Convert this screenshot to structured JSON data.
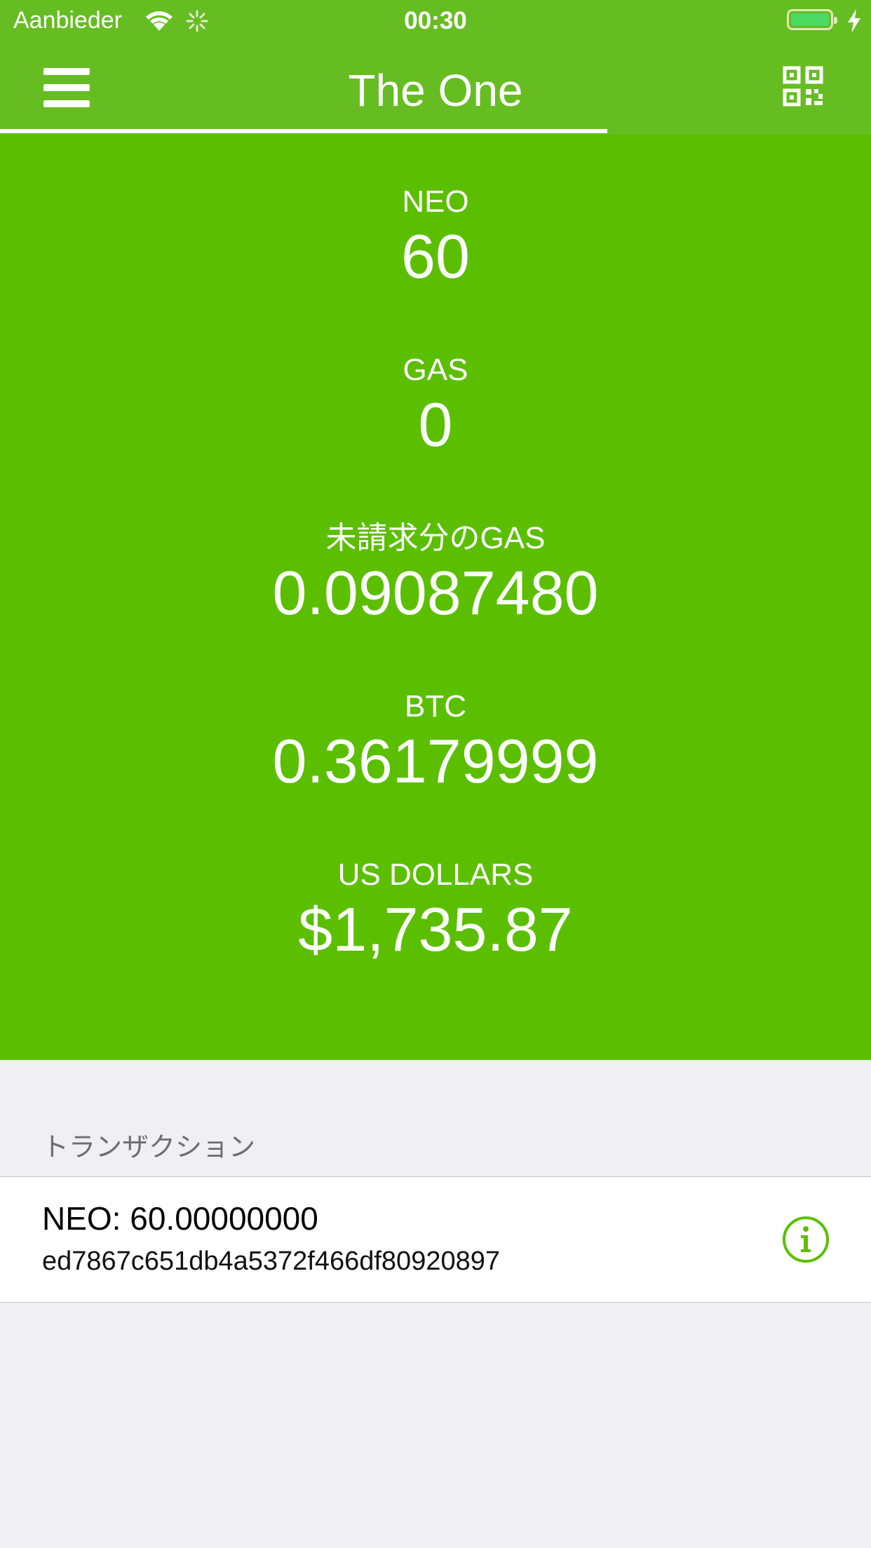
{
  "status_bar": {
    "carrier": "Aanbieder",
    "time": "00:30",
    "battery_level": 1.0
  },
  "nav": {
    "title": "The One",
    "left_icon": "menu-icon",
    "right_icon": "qr-code-icon"
  },
  "balances": [
    {
      "label": "NEO",
      "value": "60"
    },
    {
      "label": "GAS",
      "value": "0"
    },
    {
      "label": "未請求分のGAS",
      "value": "0.09087480"
    },
    {
      "label": "BTC",
      "value": "0.36179999"
    },
    {
      "label": "US DOLLARS",
      "value": "$1,735.87"
    }
  ],
  "transactions": {
    "header": "トランザクション",
    "items": [
      {
        "amount": "NEO: 60.00000000",
        "hash": "ed7867c651db4a5372f466df80920897",
        "icon": "info-icon"
      }
    ]
  },
  "colors": {
    "nav_bg": "#66bd22",
    "balance_bg": "#5bbf00",
    "page_bg": "#efeff4",
    "accent": "#5bbf00"
  }
}
